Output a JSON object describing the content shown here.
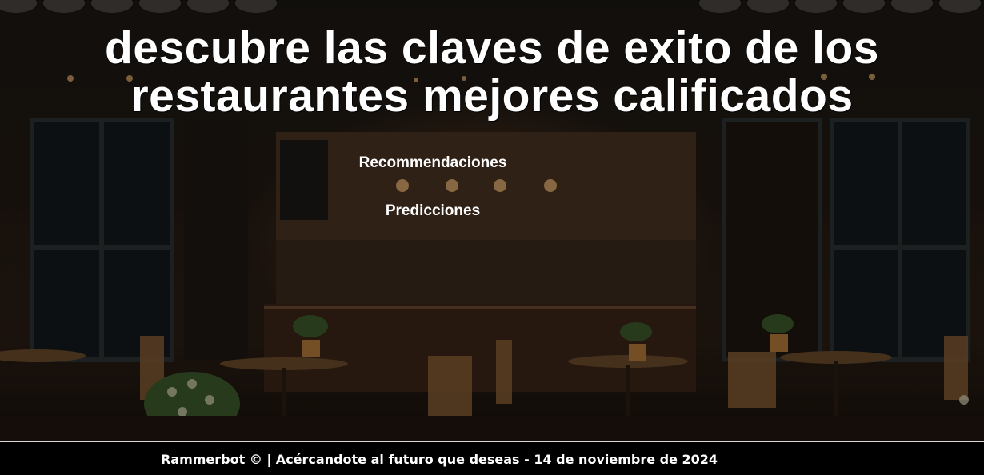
{
  "hero": {
    "title_line1": "descubre las claves de exito de los",
    "title_line2": "restaurantes mejores calificados",
    "background_image": "restaurant-cafe-facade-photo"
  },
  "nav": {
    "items": [
      {
        "label": "Recommendaciones"
      },
      {
        "label": "Predicciones"
      }
    ]
  },
  "footer": {
    "text": "Rammerbot © | Acércandote al futuro que deseas - 14 de noviembre de 2024"
  },
  "colors": {
    "text": "#ffffff",
    "footer_bg": "#000000",
    "footer_border": "#d9d9d9"
  }
}
